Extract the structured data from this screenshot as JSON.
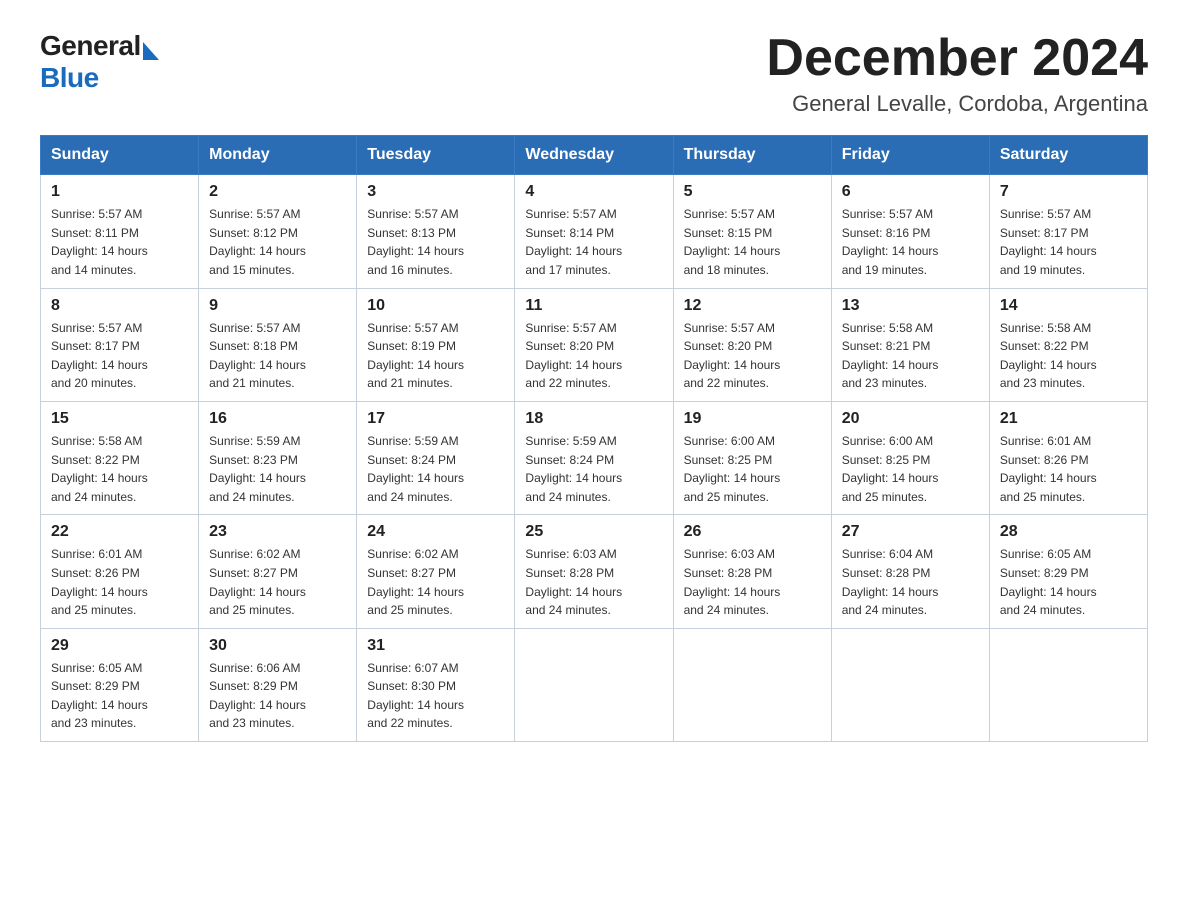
{
  "logo": {
    "text_general": "General",
    "text_blue": "Blue",
    "arrow": "▶"
  },
  "title": {
    "month_year": "December 2024",
    "location": "General Levalle, Cordoba, Argentina"
  },
  "headers": [
    "Sunday",
    "Monday",
    "Tuesday",
    "Wednesday",
    "Thursday",
    "Friday",
    "Saturday"
  ],
  "weeks": [
    [
      {
        "day": "1",
        "sunrise": "5:57 AM",
        "sunset": "8:11 PM",
        "daylight": "14 hours and 14 minutes."
      },
      {
        "day": "2",
        "sunrise": "5:57 AM",
        "sunset": "8:12 PM",
        "daylight": "14 hours and 15 minutes."
      },
      {
        "day": "3",
        "sunrise": "5:57 AM",
        "sunset": "8:13 PM",
        "daylight": "14 hours and 16 minutes."
      },
      {
        "day": "4",
        "sunrise": "5:57 AM",
        "sunset": "8:14 PM",
        "daylight": "14 hours and 17 minutes."
      },
      {
        "day": "5",
        "sunrise": "5:57 AM",
        "sunset": "8:15 PM",
        "daylight": "14 hours and 18 minutes."
      },
      {
        "day": "6",
        "sunrise": "5:57 AM",
        "sunset": "8:16 PM",
        "daylight": "14 hours and 19 minutes."
      },
      {
        "day": "7",
        "sunrise": "5:57 AM",
        "sunset": "8:17 PM",
        "daylight": "14 hours and 19 minutes."
      }
    ],
    [
      {
        "day": "8",
        "sunrise": "5:57 AM",
        "sunset": "8:17 PM",
        "daylight": "14 hours and 20 minutes."
      },
      {
        "day": "9",
        "sunrise": "5:57 AM",
        "sunset": "8:18 PM",
        "daylight": "14 hours and 21 minutes."
      },
      {
        "day": "10",
        "sunrise": "5:57 AM",
        "sunset": "8:19 PM",
        "daylight": "14 hours and 21 minutes."
      },
      {
        "day": "11",
        "sunrise": "5:57 AM",
        "sunset": "8:20 PM",
        "daylight": "14 hours and 22 minutes."
      },
      {
        "day": "12",
        "sunrise": "5:57 AM",
        "sunset": "8:20 PM",
        "daylight": "14 hours and 22 minutes."
      },
      {
        "day": "13",
        "sunrise": "5:58 AM",
        "sunset": "8:21 PM",
        "daylight": "14 hours and 23 minutes."
      },
      {
        "day": "14",
        "sunrise": "5:58 AM",
        "sunset": "8:22 PM",
        "daylight": "14 hours and 23 minutes."
      }
    ],
    [
      {
        "day": "15",
        "sunrise": "5:58 AM",
        "sunset": "8:22 PM",
        "daylight": "14 hours and 24 minutes."
      },
      {
        "day": "16",
        "sunrise": "5:59 AM",
        "sunset": "8:23 PM",
        "daylight": "14 hours and 24 minutes."
      },
      {
        "day": "17",
        "sunrise": "5:59 AM",
        "sunset": "8:24 PM",
        "daylight": "14 hours and 24 minutes."
      },
      {
        "day": "18",
        "sunrise": "5:59 AM",
        "sunset": "8:24 PM",
        "daylight": "14 hours and 24 minutes."
      },
      {
        "day": "19",
        "sunrise": "6:00 AM",
        "sunset": "8:25 PM",
        "daylight": "14 hours and 25 minutes."
      },
      {
        "day": "20",
        "sunrise": "6:00 AM",
        "sunset": "8:25 PM",
        "daylight": "14 hours and 25 minutes."
      },
      {
        "day": "21",
        "sunrise": "6:01 AM",
        "sunset": "8:26 PM",
        "daylight": "14 hours and 25 minutes."
      }
    ],
    [
      {
        "day": "22",
        "sunrise": "6:01 AM",
        "sunset": "8:26 PM",
        "daylight": "14 hours and 25 minutes."
      },
      {
        "day": "23",
        "sunrise": "6:02 AM",
        "sunset": "8:27 PM",
        "daylight": "14 hours and 25 minutes."
      },
      {
        "day": "24",
        "sunrise": "6:02 AM",
        "sunset": "8:27 PM",
        "daylight": "14 hours and 25 minutes."
      },
      {
        "day": "25",
        "sunrise": "6:03 AM",
        "sunset": "8:28 PM",
        "daylight": "14 hours and 24 minutes."
      },
      {
        "day": "26",
        "sunrise": "6:03 AM",
        "sunset": "8:28 PM",
        "daylight": "14 hours and 24 minutes."
      },
      {
        "day": "27",
        "sunrise": "6:04 AM",
        "sunset": "8:28 PM",
        "daylight": "14 hours and 24 minutes."
      },
      {
        "day": "28",
        "sunrise": "6:05 AM",
        "sunset": "8:29 PM",
        "daylight": "14 hours and 24 minutes."
      }
    ],
    [
      {
        "day": "29",
        "sunrise": "6:05 AM",
        "sunset": "8:29 PM",
        "daylight": "14 hours and 23 minutes."
      },
      {
        "day": "30",
        "sunrise": "6:06 AM",
        "sunset": "8:29 PM",
        "daylight": "14 hours and 23 minutes."
      },
      {
        "day": "31",
        "sunrise": "6:07 AM",
        "sunset": "8:30 PM",
        "daylight": "14 hours and 22 minutes."
      },
      null,
      null,
      null,
      null
    ]
  ],
  "labels": {
    "sunrise": "Sunrise:",
    "sunset": "Sunset:",
    "daylight": "Daylight:"
  }
}
